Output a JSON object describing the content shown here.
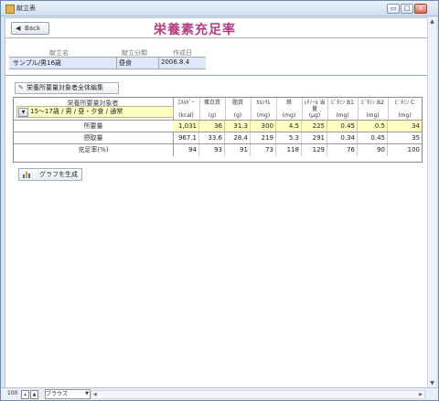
{
  "window": {
    "title": "献立表",
    "controls": {
      "minimize": "▭",
      "maximize": "□",
      "close": "x"
    }
  },
  "header": {
    "back_label": "Back",
    "page_title": "栄養素充足率"
  },
  "info": {
    "labels": {
      "menu_name": "献立名",
      "menu_type": "献立分類",
      "created": "作成日"
    },
    "menu_name": "サンプル/男16歳",
    "menu_type": "昼食",
    "created": "2006.8.4"
  },
  "edit_button_label": "栄養所要量対象者全体編集",
  "target": {
    "label": "栄養所要量対象者",
    "value": "15～17歳 / 男 / 昼・夕食 / 通常"
  },
  "table": {
    "columns": [
      {
        "name": "ｴﾈﾙｷﾞｰ",
        "unit": "(kcal)"
      },
      {
        "name": "蛋白質",
        "unit": "(g)"
      },
      {
        "name": "脂質",
        "unit": "(g)"
      },
      {
        "name": "ｶﾙｼｳﾑ",
        "unit": "(mg)"
      },
      {
        "name": "鉄",
        "unit": "(mg)"
      },
      {
        "name": "ﾚﾁﾉｰﾙ 当量",
        "unit": "(μg)"
      },
      {
        "name": "ﾋﾞﾀﾐﾝ B1",
        "unit": "(mg)"
      },
      {
        "name": "ﾋﾞﾀﾐﾝ B2",
        "unit": "(mg)"
      },
      {
        "name": "ﾋﾞﾀﾐﾝ C",
        "unit": "(mg)"
      }
    ],
    "rows": [
      {
        "label": "所要量",
        "values": [
          "1,031",
          "36",
          "31.3",
          "300",
          "4.5",
          "225",
          "0.45",
          "0.5",
          "34"
        ]
      },
      {
        "label": "摂取量",
        "values": [
          "967.1",
          "33.6",
          "28.4",
          "219",
          "5.3",
          "291",
          "0.34",
          "0.45",
          "35"
        ]
      },
      {
        "label": "充足率(%)",
        "values": [
          "94",
          "93",
          "91",
          "73",
          "118",
          "129",
          "76",
          "90",
          "100"
        ]
      }
    ]
  },
  "graph_button_label": "グラフを生成",
  "statusbar": {
    "zoom": "100",
    "mode": "ブラウズ"
  },
  "colors": {
    "title_accent": "#b23e83",
    "highlight_yellow": "#ffffc4",
    "info_row": "#e1e7f9"
  }
}
